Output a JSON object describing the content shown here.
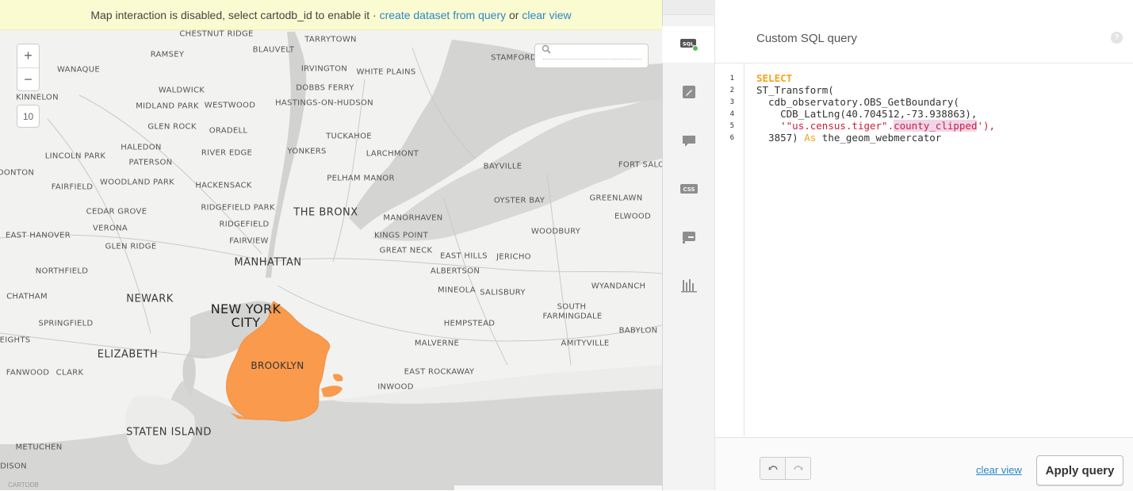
{
  "notice": {
    "text": "Map interaction is disabled, select cartodb_id to enable it ·",
    "link_create": "create dataset from query",
    "or": "or",
    "link_clear": "clear view"
  },
  "zoom": {
    "plus": "+",
    "minus": "−",
    "level": "10"
  },
  "map": {
    "places": [
      "CHESTNUT RIDGE",
      "TARRYTOWN",
      "RAMSEY",
      "BLAUVELT",
      "STAMFORD",
      "WANAQUE",
      "IRVINGTON",
      "WHITE PLAINS",
      "DOBBS FERRY",
      "WALDWICK",
      "KINNELON",
      "MIDLAND PARK",
      "WESTWOOD",
      "HASTINGS-ON-HUDSON",
      "GLEN ROCK",
      "ORADELL",
      "TUCKAHOE",
      "HALEDON",
      "RIVER EDGE",
      "YONKERS",
      "LARCHMONT",
      "LINCOLN PARK",
      "PATERSON",
      "DONTON",
      "FAIRFIELD",
      "WOODLAND PARK",
      "HACKENSACK",
      "PELHAM MANOR",
      "BAYVILLE",
      "FORT SALO",
      "GREENLAWN",
      "RIDGEFIELD PARK",
      "OYSTER BAY",
      "CEDAR GROVE",
      "ELWOOD",
      "THE BRONX",
      "MANORHAVEN",
      "VERONA",
      "RIDGEFIELD",
      "EAST HANOVER",
      "KINGS POINT",
      "WOODBURY",
      "FAIRVIEW",
      "GLEN RIDGE",
      "GREAT NECK",
      "EAST HILLS",
      "JERICHO",
      "MANHATTAN",
      "NORTHFIELD",
      "ALBERTSON",
      "WYANDANCH",
      "CHATHAM",
      "NEWARK",
      "MINEOLA",
      "SALISBURY",
      "SOUTH",
      "FARMINGDALE",
      "SPRINGFIELD",
      "BABYLON",
      "HEMPSTEAD",
      "EIGHTS",
      "MALVERNE",
      "AMITYVILLE",
      "ELIZABETH",
      "FANWOOD",
      "CLARK",
      "EAST ROCKAWAY",
      "INWOOD",
      "STATEN ISLAND",
      "METUCHEN",
      "DISON"
    ],
    "city_line1": "NEW YORK",
    "city_line2": "CITY",
    "boro": "BROOKLYN",
    "highlight_color": "#f99a4c",
    "logo": "CARTODB"
  },
  "toolbar": {
    "items": [
      "sql-icon",
      "wizard-icon",
      "infowindow-icon",
      "css-icon",
      "legend-icon",
      "filters-icon"
    ],
    "active": "sql"
  },
  "panel": {
    "title": "Custom SQL query",
    "help": "?",
    "line_numbers": [
      "1",
      "2",
      "3",
      "4",
      "5",
      "6"
    ],
    "code": {
      "l1": "SELECT",
      "l2": "ST_Transform(",
      "l3": "  cdb_observatory.OBS_GetBoundary(",
      "l4": "    CDB_LatLng(40.704512,-73.938863),",
      "l5_a": "    '",
      "l5_b": "\"us.census.tiger\".",
      "l5_c": "county_clipped",
      "l5_d": "'),",
      "l6_a": "  3857) ",
      "l6_b": "As",
      "l6_c": " the_geom_webmercator"
    },
    "clear_view": "clear view",
    "apply": "Apply query"
  }
}
